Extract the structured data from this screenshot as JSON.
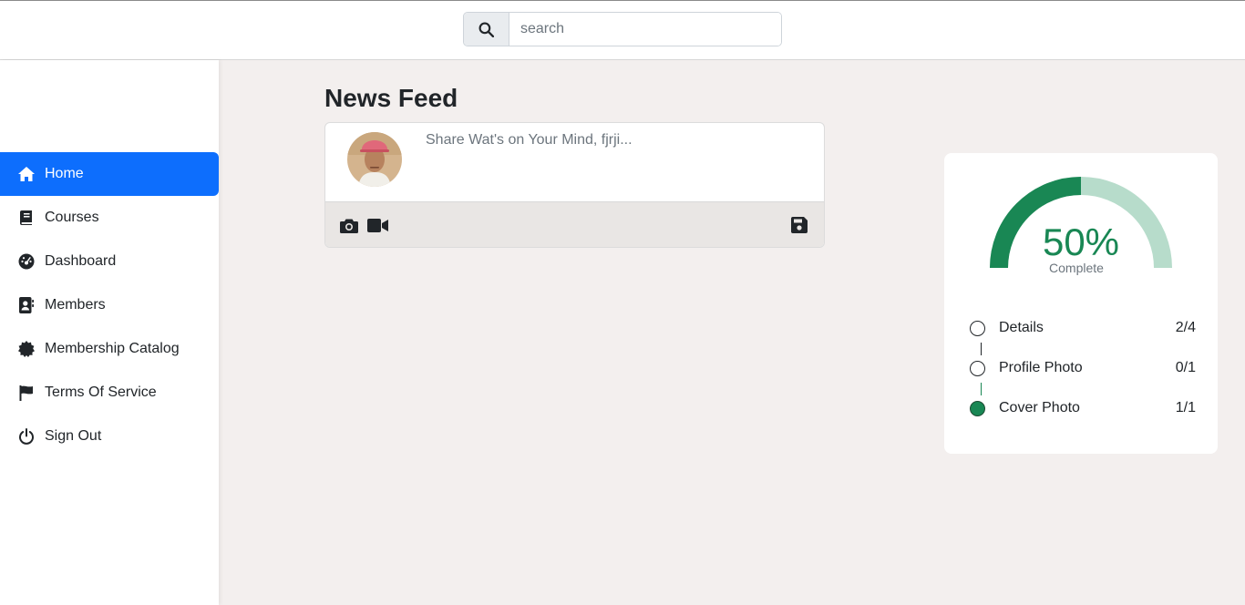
{
  "search": {
    "placeholder": "search",
    "value": ""
  },
  "sidebar": {
    "items": [
      {
        "label": "Home",
        "icon": "home-icon",
        "active": true
      },
      {
        "label": "Courses",
        "icon": "book-icon",
        "active": false
      },
      {
        "label": "Dashboard",
        "icon": "dashboard-icon",
        "active": false
      },
      {
        "label": "Members",
        "icon": "contact-card-icon",
        "active": false
      },
      {
        "label": "Membership Catalog",
        "icon": "certificate-icon",
        "active": false
      },
      {
        "label": "Terms Of Service",
        "icon": "flag-icon",
        "active": false
      },
      {
        "label": "Sign Out",
        "icon": "power-icon",
        "active": false
      }
    ]
  },
  "feed": {
    "title": "News Feed",
    "post_placeholder": "Share Wat's on Your Mind, fjrji..."
  },
  "profile_progress": {
    "percent_label": "50%",
    "percent_value": 0.5,
    "sublabel": "Complete",
    "steps": [
      {
        "label": "Details",
        "count": "2/4",
        "done": false
      },
      {
        "label": "Profile Photo",
        "count": "0/1",
        "done": false
      },
      {
        "label": "Cover Photo",
        "count": "1/1",
        "done": true
      }
    ]
  },
  "colors": {
    "accent": "#0d6efd",
    "success": "#198754",
    "success_light": "#b7dccb",
    "page_bg": "#f3efee"
  }
}
